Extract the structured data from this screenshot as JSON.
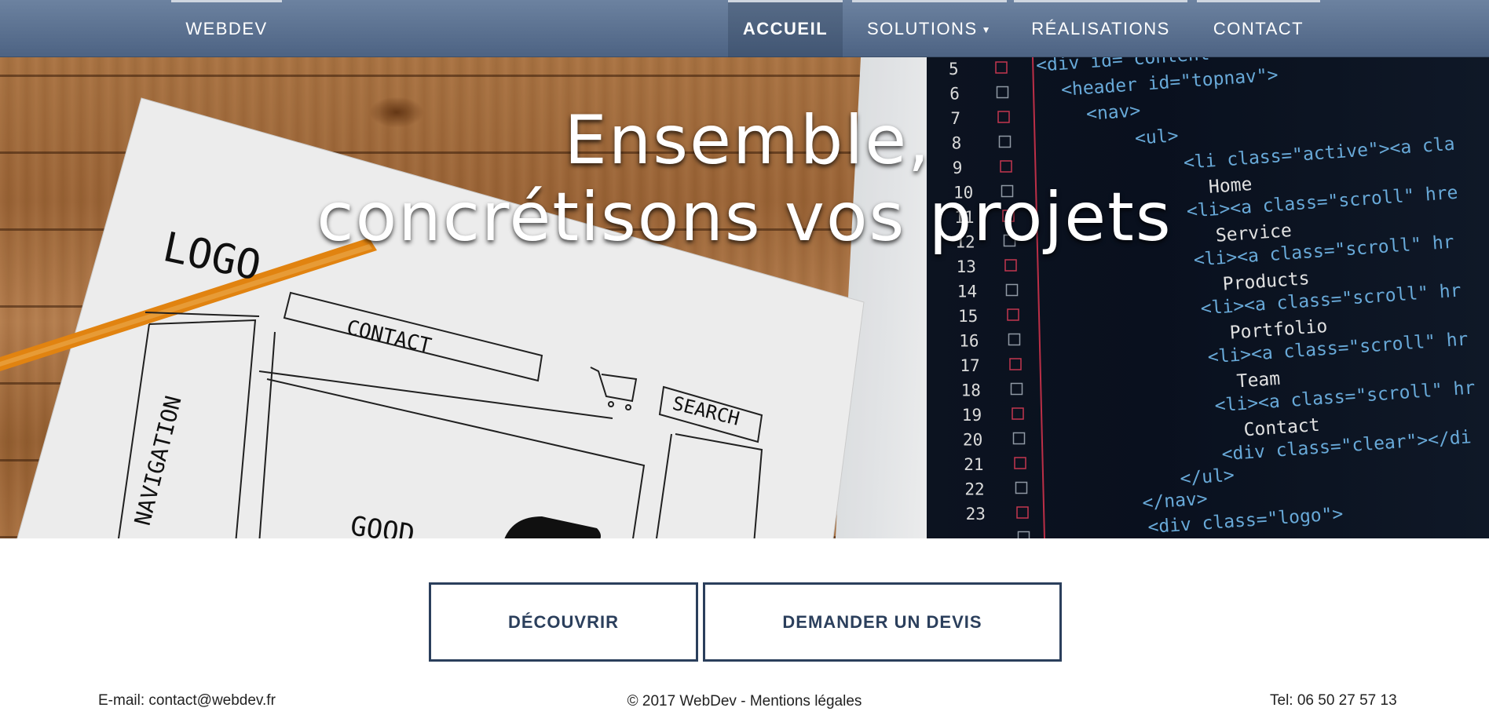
{
  "nav": {
    "brand": "WEBDEV",
    "items": [
      {
        "label": "ACCUEIL",
        "active": true
      },
      {
        "label": "SOLUTIONS",
        "has_dropdown": true
      },
      {
        "label": "RÉALISATIONS"
      },
      {
        "label": "CONTACT"
      }
    ]
  },
  "hero": {
    "line1": "Ensemble,",
    "line2": "concrétisons vos projets",
    "image_sketch_labels": [
      "LOGO",
      "CONTACT",
      "SEARCH",
      "NAVIGATION",
      "GOOD"
    ],
    "code_lines": [
      {
        "num": "5",
        "text": "<div id=\"content\">"
      },
      {
        "num": "6",
        "text": "<header id=\"topnav\">"
      },
      {
        "num": "7",
        "text": "<nav>"
      },
      {
        "num": "8",
        "text": "<ul>"
      },
      {
        "num": "9",
        "text": "<li class=\"active\"><a cla"
      },
      {
        "num": "10",
        "text": "Home"
      },
      {
        "num": "11",
        "text": "<li><a class=\"scroll\" hre"
      },
      {
        "num": "12",
        "text": "Service"
      },
      {
        "num": "13",
        "text": "<li><a class=\"scroll\" hr"
      },
      {
        "num": "14",
        "text": "Products"
      },
      {
        "num": "15",
        "text": "<li><a class=\"scroll\" hr"
      },
      {
        "num": "16",
        "text": "Portfolio"
      },
      {
        "num": "17",
        "text": "<li><a class=\"scroll\" hr"
      },
      {
        "num": "18",
        "text": "Team"
      },
      {
        "num": "19",
        "text": "<li><a class=\"scroll\" hr"
      },
      {
        "num": "20",
        "text": "Contact"
      },
      {
        "num": "21",
        "text": "<div class=\"clear\"></di"
      },
      {
        "num": "22",
        "text": "</ul>"
      },
      {
        "num": "23",
        "text": "</nav>"
      },
      {
        "num": "",
        "text": "<div class=\"logo\">"
      }
    ]
  },
  "buttons": {
    "discover": "DÉCOUVRIR",
    "quote": "DEMANDER UN DEVIS"
  },
  "footer": {
    "email": "E-mail: contact@webdev.fr",
    "copyright": "© 2017 WebDev - Mentions légales",
    "tel": "Tel: 06 50 27 57 13"
  },
  "colors": {
    "navbar": "#5f7594",
    "button_border": "#2b3f5c",
    "code_background": "#0d1522"
  }
}
